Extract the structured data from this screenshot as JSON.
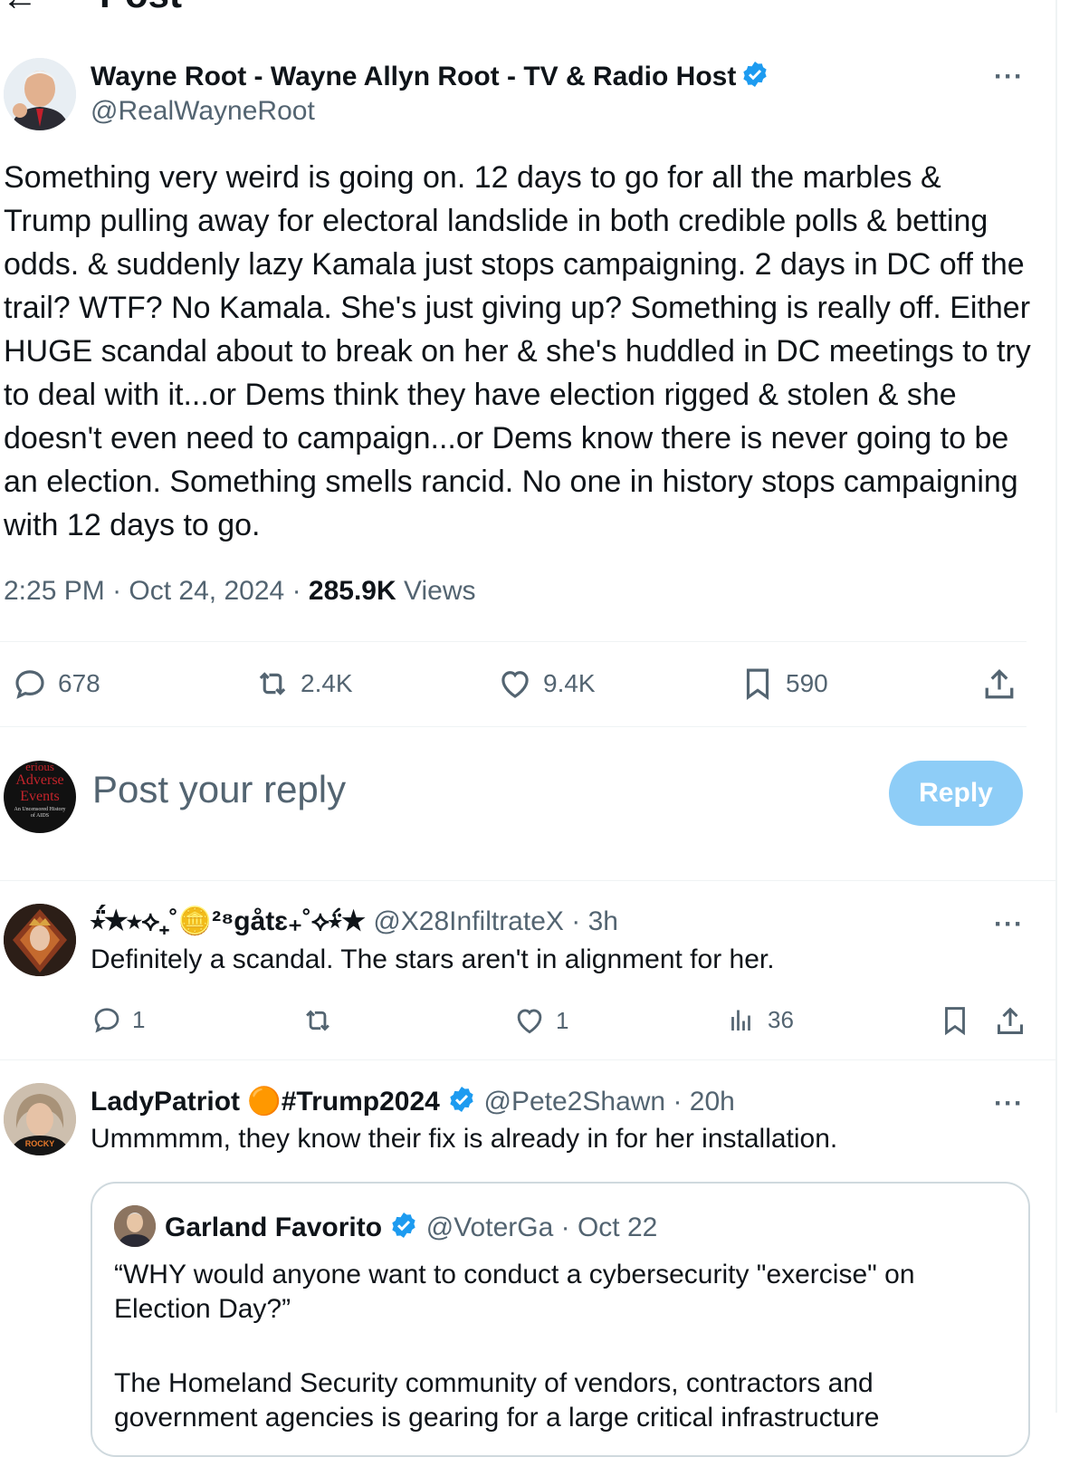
{
  "header": {
    "back_icon": "arrow-left-icon",
    "title": "Post"
  },
  "post": {
    "display_name": "Wayne Root - Wayne Allyn Root - TV & Radio Host",
    "handle": "@RealWayneRoot",
    "text": "Something very weird is going on. 12 days to go for all the marbles & Trump pulling away for electoral landslide in both credible polls & betting odds. & suddenly lazy Kamala just stops campaigning. 2 days in DC off the trail? WTF? No Kamala. She's just giving up? Something is really off. Either HUGE scandal about to break on her & she's huddled in DC meetings to try to deal with it...or Dems think they have election rigged & stolen & she doesn't even need to campaign...or Dems know there is never going to be an election. Something smells rancid. No one in history stops campaigning with 12 days to go.",
    "time": "2:25 PM",
    "sep": "·",
    "date": "Oct 24, 2024",
    "views_count": "285.9K",
    "views_label": "Views",
    "more": "···",
    "stats": {
      "replies": "678",
      "reposts": "2.4K",
      "likes": "9.4K",
      "bookmarks": "590"
    }
  },
  "composer": {
    "placeholder": "Post your reply",
    "button_label": "Reply",
    "avatar_text": [
      "erious",
      "Adverse",
      "Events",
      "An Uncensored History",
      "of AIDS"
    ]
  },
  "replies": [
    {
      "display_name": "⭒̈́★⭑⟡₊˚🪙²⁸gåtɛ₊˚⟡⭒̈́★",
      "handle": "@X28InfiltrateX",
      "age": "3h",
      "text": "Definitely a scandal. The stars aren't in alignment for her.",
      "stats": {
        "replies": "1",
        "reposts": "",
        "likes": "1",
        "views": "36"
      },
      "more": "···"
    },
    {
      "display_name_main": "LadyPatriot",
      "display_name_suffix": "#Trump2024",
      "emoji": "🟠",
      "handle": "@Pete2Shawn",
      "age": "20h",
      "text": "Ummmmm, they know their fix is already in for her installation.",
      "more": "···",
      "avatar_text": "ROCKY",
      "quote": {
        "display_name": "Garland Favorito",
        "handle": "@VoterGa",
        "date": "Oct 22",
        "text1": "“WHY would anyone want to conduct a cybersecurity \"exercise\" on Election Day?”",
        "text2": "The Homeland Security community of vendors, contractors and",
        "text3": "government agencies is gearing for a large critical infrastructure"
      }
    }
  ],
  "colors": {
    "accent": "#1d9bf0",
    "muted": "#536471",
    "reply_button": "#8ecdf7",
    "divider": "#eff3f4"
  }
}
